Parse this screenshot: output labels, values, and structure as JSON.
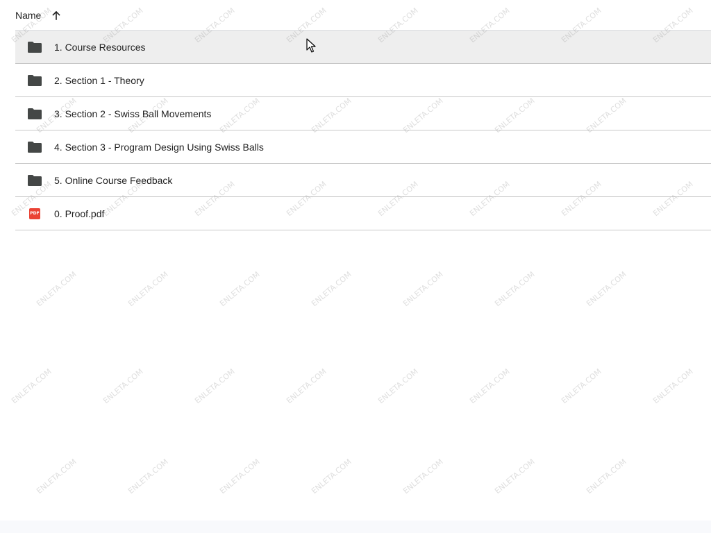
{
  "header": {
    "name_label": "Name",
    "sort_icon": "arrow-up-icon"
  },
  "files": [
    {
      "label": "1. Course Resources",
      "icon": "folder-icon",
      "hover": true
    },
    {
      "label": "2. Section 1 - Theory",
      "icon": "folder-icon",
      "hover": false
    },
    {
      "label": "3. Section 2 - Swiss Ball Movements",
      "icon": "folder-icon",
      "hover": false
    },
    {
      "label": "4. Section 3 - Program Design Using Swiss Balls",
      "icon": "folder-icon",
      "hover": false
    },
    {
      "label": "5. Online Course Feedback",
      "icon": "folder-icon",
      "hover": false
    },
    {
      "label": "0. Proof.pdf",
      "icon": "pdf-icon",
      "hover": false,
      "badge": "PDF"
    }
  ],
  "watermark": {
    "text": "ENLETA.COM"
  },
  "colors": {
    "folder": "#444746",
    "pdf": "#ea4335",
    "hover_row": "#eeeeee",
    "divider": "#c7c7c7"
  }
}
